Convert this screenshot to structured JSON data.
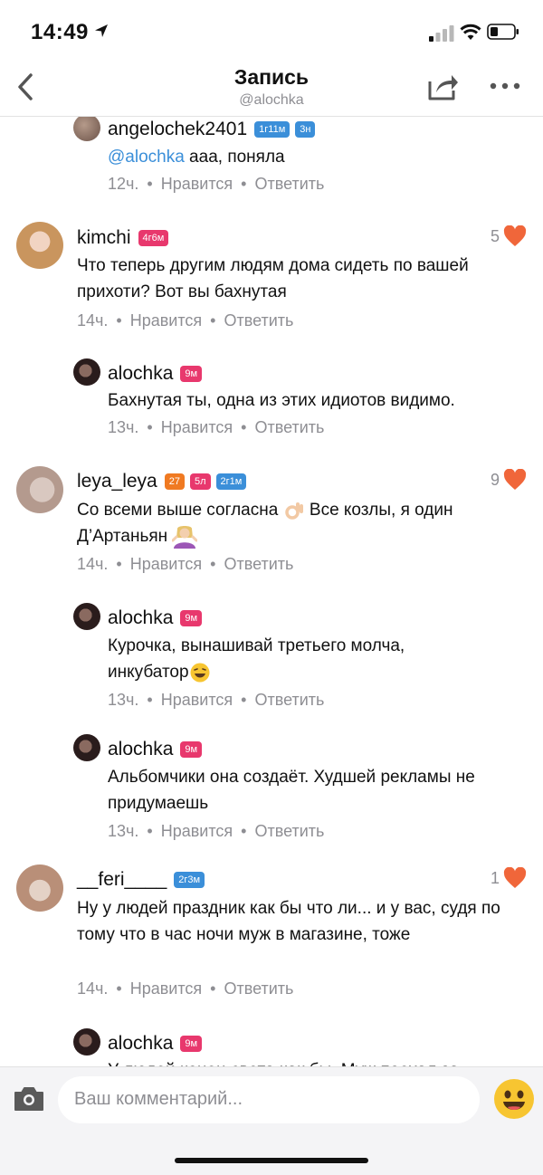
{
  "status": {
    "time": "14:49"
  },
  "header": {
    "title": "Запись",
    "subtitle": "@alochka"
  },
  "actions": {
    "dot": "•",
    "like": "Нравится",
    "reply": "Ответить"
  },
  "comments": [
    {
      "user": "angelochek2401",
      "badges": [
        "1г11м",
        "3н"
      ],
      "mention": "@alochka",
      "text": " ааа, поняла",
      "time": "12ч."
    },
    {
      "user": "kimchi",
      "badges": [
        "4г6м"
      ],
      "text": "Что теперь другим людям дома сидеть по вашей прихоти? Вот вы бахнутая",
      "time": "14ч.",
      "likes": "5"
    },
    {
      "user": "alochka",
      "badges": [
        "9м"
      ],
      "text": "Бахнутая ты, одна из этих идиотов видимо.",
      "time": "13ч."
    },
    {
      "user": "leya_leya",
      "badges": [
        "27",
        "5л",
        "2г1м"
      ],
      "text1": "Со всеми выше согласна",
      "text2": "Все козлы, я один",
      "text3": "Д’Артаньян",
      "time": "14ч.",
      "likes": "9"
    },
    {
      "user": "alochka",
      "badges": [
        "9м"
      ],
      "text": "Курочка, вынашивай третьего молча, инкубатор",
      "time": "13ч."
    },
    {
      "user": "alochka",
      "badges": [
        "9м"
      ],
      "text": "Альбомчики она создаёт. Худшей рекламы не придумаешь",
      "time": "13ч."
    },
    {
      "user": "__feri____",
      "badges": [
        "2г3м"
      ],
      "text": "Ну у людей праздник как бы что ли... и у вас, судя по тому что в час ночи муж в магазине, тоже",
      "time": "14ч.",
      "likes": "1"
    },
    {
      "user": "alochka",
      "badges": [
        "9м"
      ],
      "text": "У людей конец света как бы. Муж поехал за"
    }
  ],
  "composer": {
    "placeholder": "Ваш комментарий..."
  },
  "colors": {
    "accent": "#3b8fd9",
    "badge_pink": "#e8386d",
    "badge_blue": "#3b8fd9",
    "badge_orange": "#f07a22",
    "heart": "#f0663a"
  }
}
